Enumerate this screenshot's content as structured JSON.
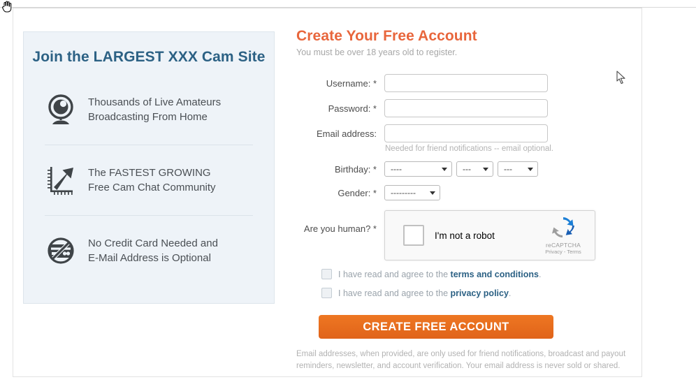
{
  "promo": {
    "title": "Join the LARGEST XXX Cam Site",
    "features": [
      {
        "icon": "webcam-icon",
        "line1": "Thousands of Live Amateurs",
        "line2": "Broadcasting From Home"
      },
      {
        "icon": "growth-chart-icon",
        "line1": "The FASTEST GROWING",
        "line2": "Free Cam Chat Community"
      },
      {
        "icon": "no-credit-card-icon",
        "line1": "No Credit Card Needed and",
        "line2": "E-Mail Address is Optional"
      }
    ]
  },
  "form": {
    "title": "Create Your Free Account",
    "subtitle": "You must be over 18 years old to register.",
    "username": {
      "label": "Username: *",
      "value": "",
      "placeholder": ""
    },
    "password": {
      "label": "Password: *",
      "value": "",
      "placeholder": ""
    },
    "email": {
      "label": "Email address:",
      "value": "",
      "placeholder": "",
      "hint": "Needed for friend notifications -- email optional."
    },
    "birthday": {
      "label": "Birthday: *",
      "month": "----",
      "day": "---",
      "year": "---"
    },
    "gender": {
      "label": "Gender: *",
      "value": "---------"
    },
    "captcha": {
      "label": "Are you human? *",
      "checkbox_text": "I'm not a robot",
      "brand": "reCAPTCHA",
      "legal": "Privacy - Terms",
      "checked": false
    },
    "terms": {
      "prefix": "I have read and agree to the ",
      "link": "terms and conditions",
      "suffix": ".",
      "checked": false
    },
    "privacy": {
      "prefix": "I have read and agree to the ",
      "link": "privacy policy",
      "suffix": ".",
      "checked": false
    },
    "submit_label": "CREATE FREE ACCOUNT",
    "footer": "Email addresses, when provided, are only used for friend notifications, broadcast and payout reminders, newsletter, and account verification. Your email address is never sold or shared."
  },
  "colors": {
    "accent_orange": "#e8663c",
    "button_orange": "#e8701a",
    "panel_blue": "#2c6184",
    "panel_bg": "#eef3f8"
  }
}
